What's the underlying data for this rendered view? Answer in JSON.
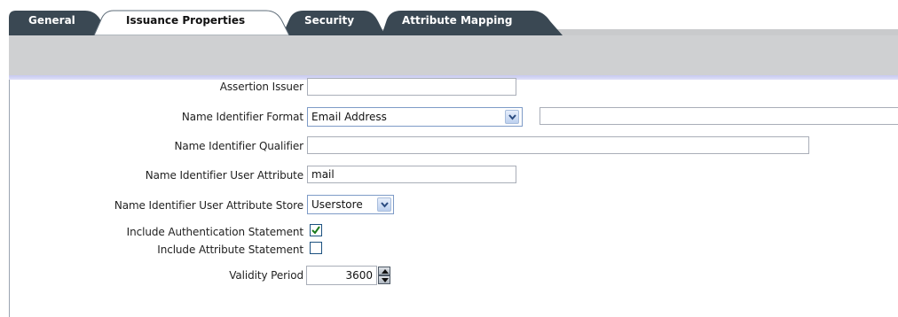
{
  "tabs": [
    {
      "label": "General",
      "active": false
    },
    {
      "label": "Issuance Properties",
      "active": true
    },
    {
      "label": "Security",
      "active": false
    },
    {
      "label": "Attribute Mapping",
      "active": false
    }
  ],
  "form": {
    "assertion_issuer": {
      "label": "Assertion Issuer",
      "value": ""
    },
    "name_id_format": {
      "label": "Name Identifier Format",
      "selected": "Email Address",
      "extra_value": ""
    },
    "name_id_qualifier": {
      "label": "Name Identifier Qualifier",
      "value": ""
    },
    "name_id_user_attribute": {
      "label": "Name Identifier User Attribute",
      "value": "mail"
    },
    "name_id_user_attribute_store": {
      "label": "Name Identifier User Attribute Store",
      "selected": "Userstore"
    },
    "include_auth_statement": {
      "label": "Include Authentication Statement",
      "checked": true
    },
    "include_attr_statement": {
      "label": "Include Attribute Statement",
      "checked": false
    },
    "validity_period": {
      "label": "Validity Period",
      "value": "3600"
    }
  },
  "colors": {
    "tab_dark": "#3c4a55",
    "tab_active": "#ffffff",
    "band": "#cfd0d2",
    "accent_line": "#c7c9f0"
  }
}
